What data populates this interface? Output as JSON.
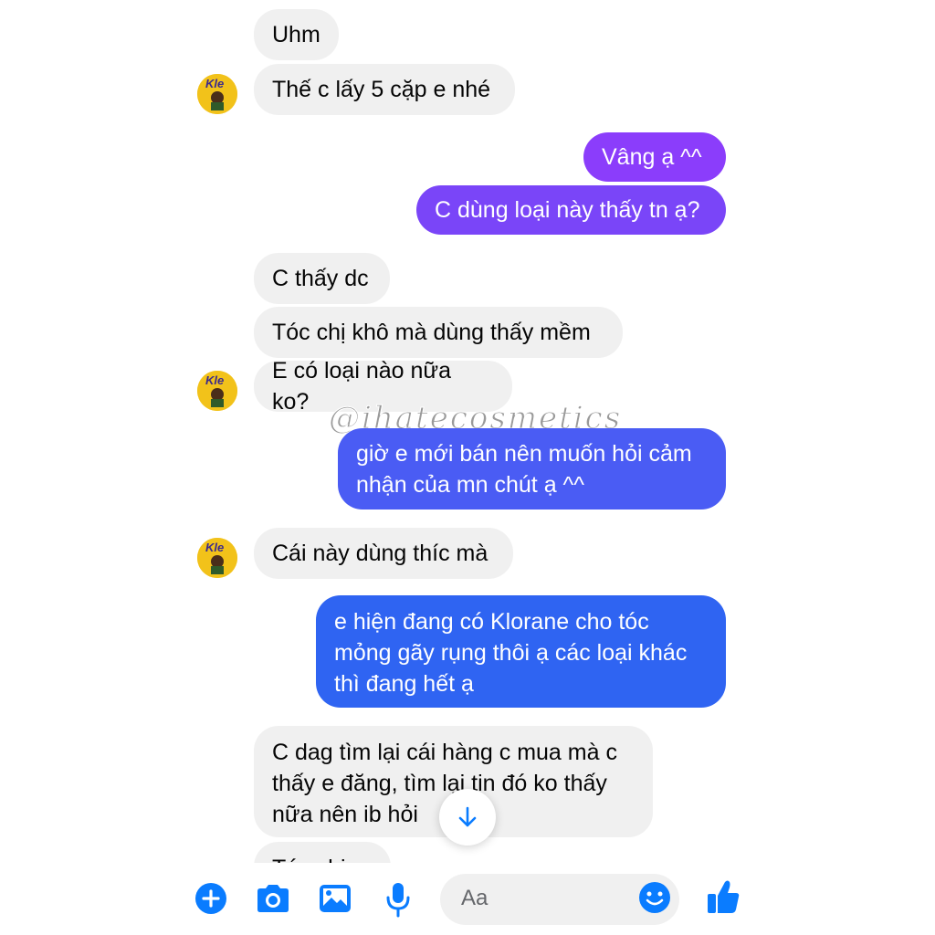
{
  "colors": {
    "incoming_bg": "#f0f0f0",
    "outgoing_top": "#8b3dfb",
    "outgoing_mid": "#6a4cf6",
    "outgoing_bottom": "#2f64f2",
    "accent_blue": "#0a7cff"
  },
  "watermark": "@ihatecosmetics",
  "messages": [
    {
      "text": "Uhm"
    },
    {
      "text": "Thế c lấy 5 cặp e nhé"
    },
    {
      "text": "Vâng ạ ^^"
    },
    {
      "text": "C dùng loại này thấy tn ạ?"
    },
    {
      "text": "C thấy dc"
    },
    {
      "text": "Tóc chị khô mà dùng thấy mềm"
    },
    {
      "text": "E có loại nào nữa ko?"
    },
    {
      "text": "giờ e mới bán nên muốn hỏi cảm\nnhận của mn chút ạ ^^"
    },
    {
      "text": "Cái này dùng thíc mà"
    },
    {
      "text": "e hiện đang có Klorane cho tóc\nmỏng gãy rụng thôi ạ các loại khác\nthì đang hết ạ"
    },
    {
      "text": "C dag tìm lại cái hàng c mua mà c\nthấy e đăng, tìm lại tin đó ko thấy\nnữa nên ib hỏi"
    },
    {
      "text": "Tóc chị..."
    }
  ],
  "composer": {
    "placeholder": "Aa",
    "icons": [
      "plus-icon",
      "camera-icon",
      "image-icon",
      "microphone-icon",
      "emoji-icon",
      "thumbs-up-icon"
    ]
  }
}
